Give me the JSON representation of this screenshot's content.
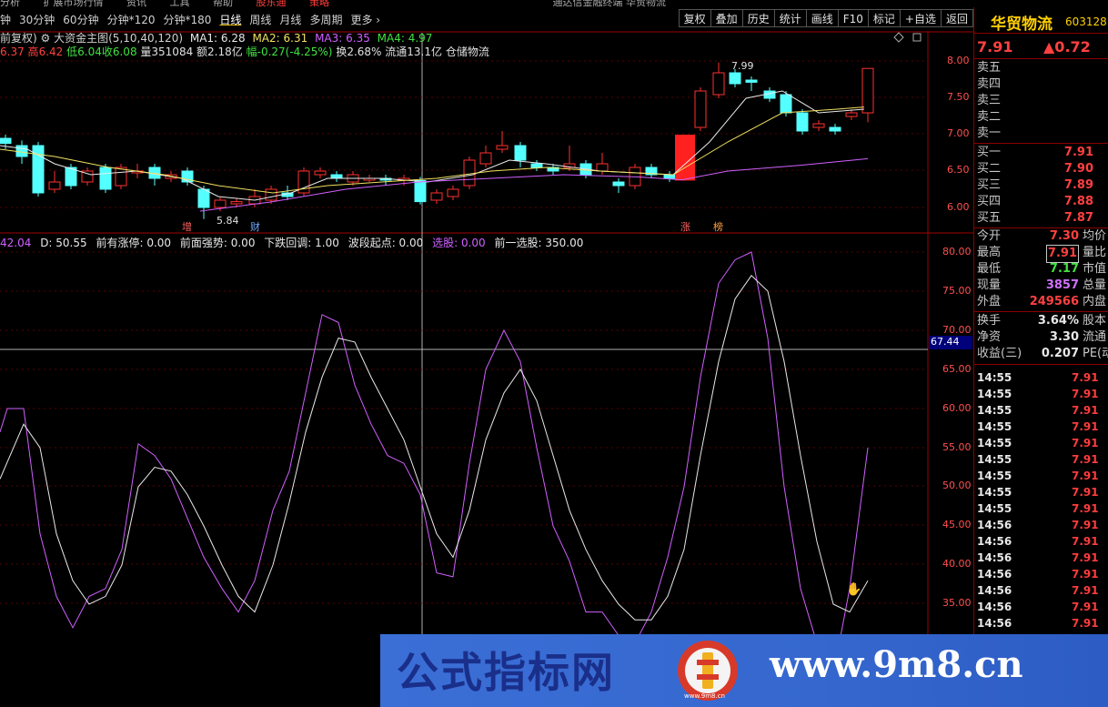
{
  "menu_strip": [
    "分析",
    "扩展市场行情",
    "资讯",
    "工具",
    "帮助",
    "股东通",
    "策略"
  ],
  "period_tabs": [
    "钟",
    "30分钟",
    "60分钟",
    "分钟*120",
    "分钟*180",
    "日线",
    "周线",
    "月线",
    "多周期",
    "更多"
  ],
  "active_period": "日线",
  "window_title": "通达信金融终端 华贸物流",
  "func_buttons": [
    "复权",
    "叠加",
    "历史",
    "统计",
    "画线",
    "F10",
    "标记",
    "+自选",
    "返回"
  ],
  "main_panel": {
    "restore_label": "前复权",
    "indicator_name": "大资金主图(5,10,40,120)",
    "ma1": "MA1: 6.28",
    "ma2": "MA2: 6.31",
    "ma3": "MA3: 6.35",
    "ma4": "MA4: 4.97",
    "ohlc": {
      "open": "6.37",
      "high_label": "高",
      "high": "6.42",
      "low_label": "低",
      "low": "6.04",
      "close_label": "收",
      "close": "6.08",
      "volume": "量351084",
      "amount": "额2.18亿",
      "change": "幅-0.27(-4.25%)",
      "turnover": "换2.68%",
      "float_cap": "流通13.1亿",
      "sector": "仓储物流"
    },
    "price_axis": [
      "8.00",
      "7.50",
      "7.00",
      "6.50",
      "6.00"
    ],
    "high_mark": "7.99",
    "low_mark": "5.84",
    "markers": [
      {
        "text": "增",
        "color": "#ff6060"
      },
      {
        "text": "财",
        "color": "#6fa8ff"
      },
      {
        "text": "涨",
        "color": "#ff6060"
      },
      {
        "text": "榜",
        "color": "#ffa040"
      }
    ]
  },
  "sub_panel": {
    "k_value": "42.04",
    "d_value": "D: 50.55",
    "p1": "前有涨停: 0.00",
    "p2": "前面强势: 0.00",
    "p3": "下跌回调: 1.00",
    "p4": "波段起点: 0.00",
    "p5": "选股: 0.00",
    "p6": "前一选股: 350.00",
    "axis": [
      "80.00",
      "75.00",
      "70.00",
      "65.00",
      "60.00",
      "55.00",
      "50.00",
      "45.00",
      "40.00",
      "35.00"
    ],
    "cursor_value": "67.44"
  },
  "quote_panel": {
    "name": "华贸物流",
    "code": "603128",
    "price": "7.91",
    "change": "▲0.72",
    "sell_levels": [
      "卖五",
      "卖四",
      "卖三",
      "卖二",
      "卖一"
    ],
    "buy_levels": [
      {
        "label": "买一",
        "price": "7.91"
      },
      {
        "label": "买二",
        "price": "7.90"
      },
      {
        "label": "买三",
        "price": "7.89"
      },
      {
        "label": "买四",
        "price": "7.88"
      },
      {
        "label": "买五",
        "price": "7.87"
      }
    ],
    "stats": [
      {
        "label": "今开",
        "value": "7.30",
        "extra": "均价",
        "color": "#ff4040"
      },
      {
        "label": "最高",
        "value": "7.91",
        "extra": "量比",
        "color": "#ff4040",
        "boxed": true
      },
      {
        "label": "最低",
        "value": "7.17",
        "extra": "市值",
        "color": "#40e040"
      },
      {
        "label": "现量",
        "value": "3857",
        "extra": "总量",
        "color": "#d070ff"
      },
      {
        "label": "外盘",
        "value": "249566",
        "extra": "内盘",
        "color": "#ff4040"
      }
    ],
    "stats2": [
      {
        "label": "换手",
        "value": "3.64%",
        "extra": "股本"
      },
      {
        "label": "净资",
        "value": "3.30",
        "extra": "流通"
      },
      {
        "label": "收益(三)",
        "value": "0.207",
        "extra": "PE(动"
      }
    ],
    "ticks": [
      {
        "time": "14:55",
        "price": "7.91"
      },
      {
        "time": "14:55",
        "price": "7.91"
      },
      {
        "time": "14:55",
        "price": "7.91"
      },
      {
        "time": "14:55",
        "price": "7.91"
      },
      {
        "time": "14:55",
        "price": "7.91"
      },
      {
        "time": "14:55",
        "price": "7.91"
      },
      {
        "time": "14:55",
        "price": "7.91"
      },
      {
        "time": "14:55",
        "price": "7.91"
      },
      {
        "time": "14:55",
        "price": "7.91"
      },
      {
        "time": "14:56",
        "price": "7.91"
      },
      {
        "time": "14:56",
        "price": "7.91"
      },
      {
        "time": "14:56",
        "price": "7.91"
      },
      {
        "time": "14:56",
        "price": "7.91"
      },
      {
        "time": "14:56",
        "price": "7.91"
      },
      {
        "time": "14:56",
        "price": "7.91"
      },
      {
        "time": "14:56",
        "price": "7.91"
      }
    ]
  },
  "watermark": {
    "left_text": "公式指标网",
    "right_text": "www.9m8.cn",
    "logo_text": "www.9m8.cn"
  }
}
